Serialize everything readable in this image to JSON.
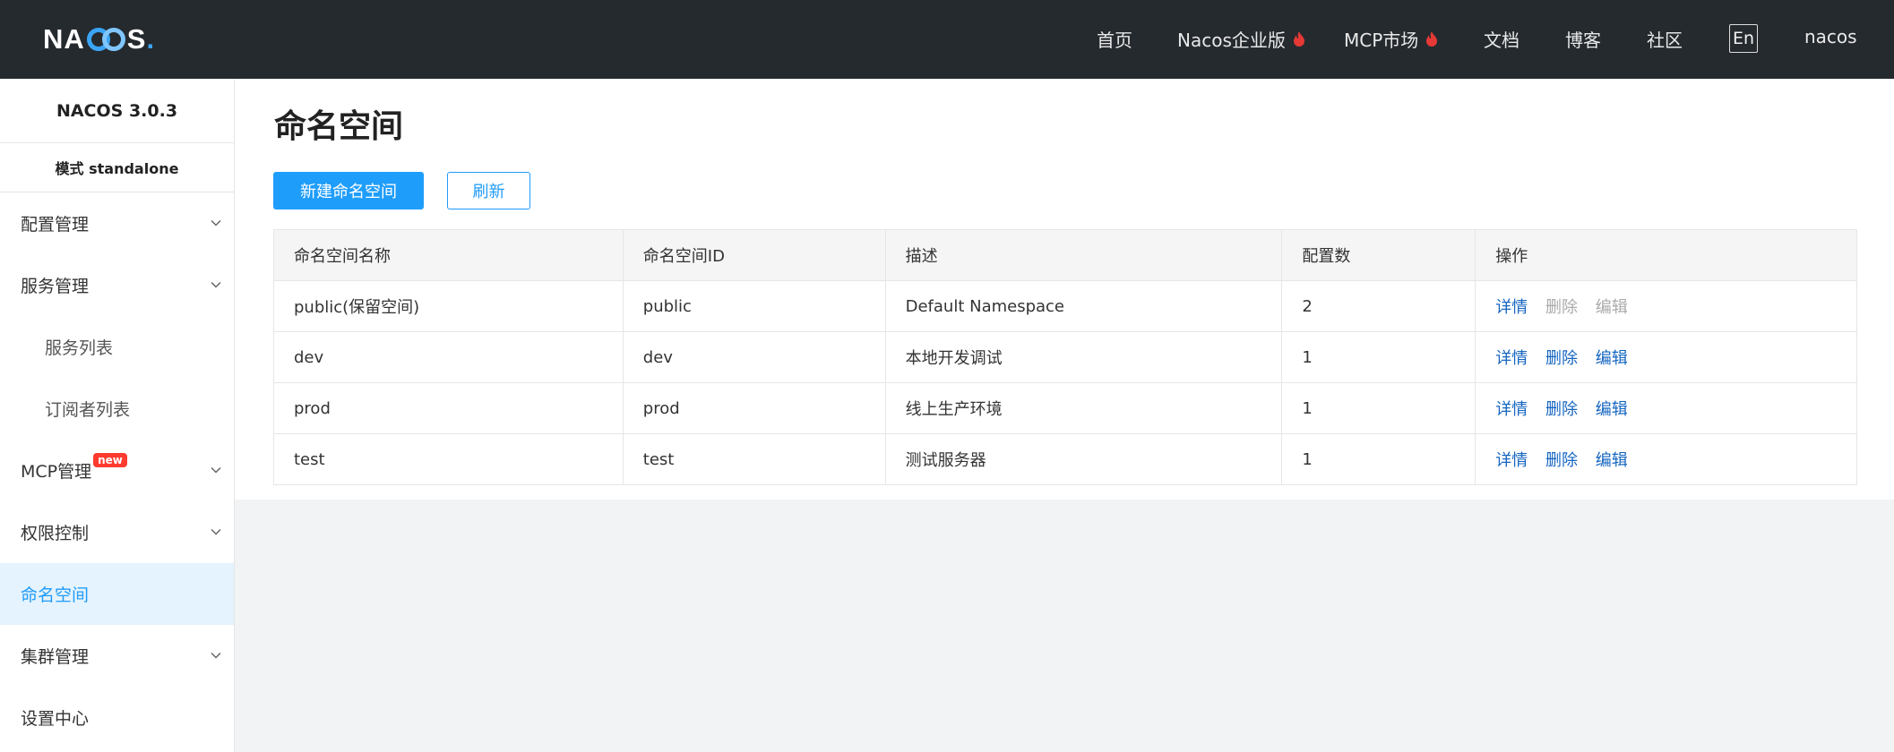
{
  "header": {
    "logo_text": "NACOS",
    "nav": [
      {
        "label": "首页",
        "hot": false
      },
      {
        "label": "Nacos企业版",
        "hot": true
      },
      {
        "label": "MCP市场",
        "hot": true
      },
      {
        "label": "文档",
        "hot": false
      },
      {
        "label": "博客",
        "hot": false
      },
      {
        "label": "社区",
        "hot": false
      }
    ],
    "lang": "En",
    "user": "nacos"
  },
  "sidebar": {
    "version": "NACOS 3.0.3",
    "mode": "模式  standalone",
    "items": [
      {
        "label": "配置管理",
        "expandable": true
      },
      {
        "label": "服务管理",
        "expandable": true
      },
      {
        "label": "服务列表",
        "sub": true
      },
      {
        "label": "订阅者列表",
        "sub": true
      },
      {
        "label": "MCP管理",
        "expandable": true,
        "badge": "new"
      },
      {
        "label": "权限控制",
        "expandable": true
      },
      {
        "label": "命名空间",
        "active": true
      },
      {
        "label": "集群管理",
        "expandable": true
      },
      {
        "label": "设置中心"
      }
    ]
  },
  "main": {
    "title": "命名空间",
    "create_button": "新建命名空间",
    "refresh_button": "刷新",
    "table": {
      "columns": [
        "命名空间名称",
        "命名空间ID",
        "描述",
        "配置数",
        "操作"
      ],
      "rows": [
        {
          "name": "public(保留空间)",
          "id": "public",
          "desc": "Default Namespace",
          "count": "2",
          "ops_enabled": false
        },
        {
          "name": "dev",
          "id": "dev",
          "desc": "本地开发调试",
          "count": "1",
          "ops_enabled": true
        },
        {
          "name": "prod",
          "id": "prod",
          "desc": "线上生产环境",
          "count": "1",
          "ops_enabled": true
        },
        {
          "name": "test",
          "id": "test",
          "desc": "测试服务器",
          "count": "1",
          "ops_enabled": true
        }
      ],
      "ops": {
        "detail": "详情",
        "delete": "删除",
        "edit": "编辑"
      }
    }
  },
  "colors": {
    "topbar": "#252a2f",
    "primary": "#1f9dfb",
    "link": "#1565c0",
    "disabled": "#aaaaaa",
    "hot": "#e53935"
  }
}
